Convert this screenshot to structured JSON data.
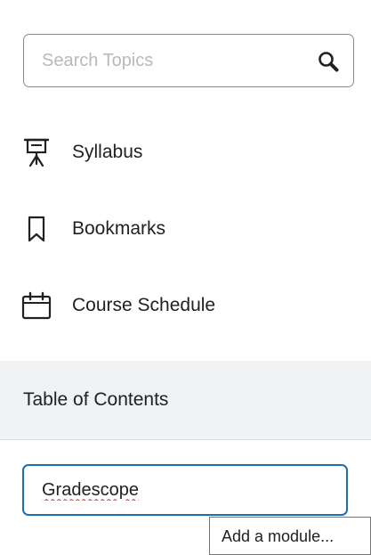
{
  "search": {
    "placeholder": "Search Topics",
    "value": "",
    "icon": "search-icon"
  },
  "nav": [
    {
      "label": "Syllabus",
      "icon": "presentation-icon"
    },
    {
      "label": "Bookmarks",
      "icon": "bookmark-icon"
    },
    {
      "label": "Course Schedule",
      "icon": "calendar-icon"
    }
  ],
  "toc": {
    "label": "Table of Contents"
  },
  "module_input": {
    "value": "Gradescope"
  },
  "tooltip": {
    "text": "Add a module..."
  },
  "colors": {
    "focus_border": "#1f6db3",
    "spellcheck": "#d9262b",
    "toc_background": "#f1f2f4"
  }
}
